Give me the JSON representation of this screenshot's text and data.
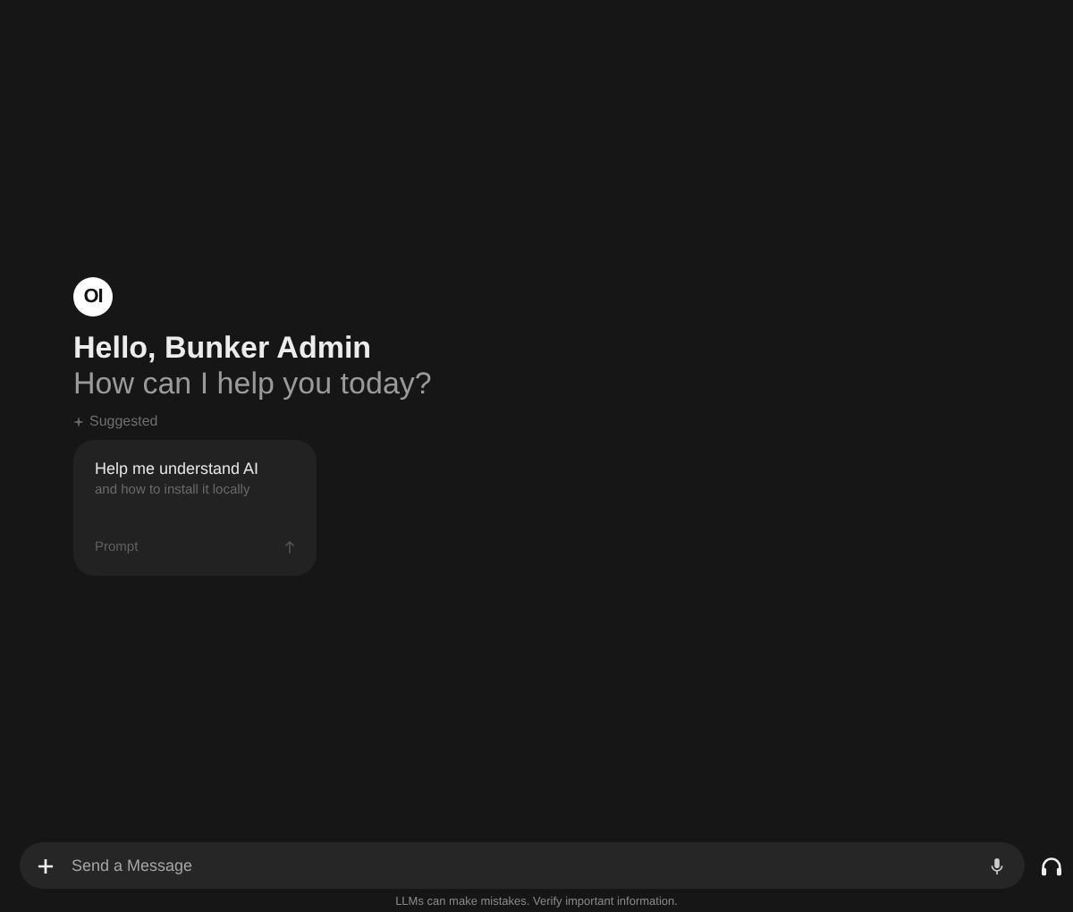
{
  "logo": {
    "text": "OI"
  },
  "greeting": {
    "title": "Hello, Bunker Admin",
    "subtitle": "How can I help you today?"
  },
  "suggested": {
    "label": "Suggested",
    "cards": [
      {
        "title": "Help me understand AI",
        "subtitle": "and how to install it locally",
        "footer": "Prompt"
      }
    ]
  },
  "composer": {
    "placeholder": "Send a Message"
  },
  "disclaimer": "LLMs can make mistakes. Verify important information."
}
